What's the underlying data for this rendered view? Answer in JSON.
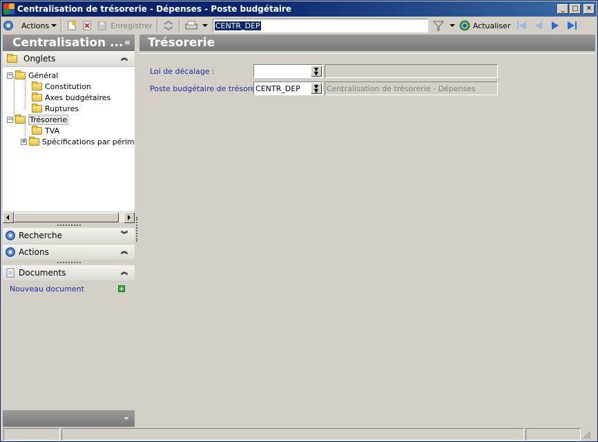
{
  "window": {
    "title": "Centralisation de trésorerie - Dépenses -  Poste budgétaire",
    "controls": {
      "minimize": "_",
      "maximize": "□",
      "close": "✕"
    },
    "brand_colors": [
      "#e03a2a",
      "#f2b21a",
      "#2a8a3a",
      "#2a5aa6"
    ]
  },
  "toolbar": {
    "actions_label": "Actions",
    "save_label": "Enregistrer",
    "search_value": "CENTR_DEP",
    "refresh_label": "Actualiser",
    "icons": [
      "nav-circle-icon",
      "new-document-icon",
      "delete-icon",
      "save-icon",
      "sync-icon",
      "print-icon",
      "filter-icon",
      "refresh-icon",
      "first-icon",
      "previous-icon",
      "next-icon",
      "last-icon"
    ]
  },
  "left_panel": {
    "title": "Centralisation ...",
    "collapse_glyph": "«",
    "onglets": {
      "label": "Onglets",
      "tree": [
        {
          "label": "Général",
          "level": 0,
          "expanded": true
        },
        {
          "label": "Constitution",
          "level": 1
        },
        {
          "label": "Axes budgétaires",
          "level": 1
        },
        {
          "label": "Ruptures",
          "level": 1
        },
        {
          "label": "Trésorerie",
          "level": 0,
          "expanded": true,
          "selected": true
        },
        {
          "label": "TVA",
          "level": 1
        },
        {
          "label": "Spécifications par périmètre",
          "level": 1,
          "expandable": true
        }
      ]
    },
    "recherche_label": "Recherche",
    "actions_label": "Actions",
    "documents_label": "Documents",
    "new_document_label": "Nouveau document"
  },
  "main": {
    "title": "Trésorerie",
    "fields": {
      "loi_decalage": {
        "label": "Loi de décalage :",
        "value": "",
        "description": ""
      },
      "poste_budgetaire": {
        "label": "Poste budgétaire de trésorerie :",
        "value": "CENTR_DEP",
        "description": "Centralisation de trésorerie - Dépenses"
      }
    }
  }
}
